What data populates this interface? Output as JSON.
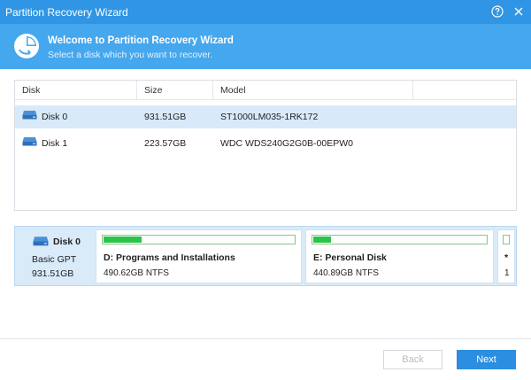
{
  "window": {
    "title": "Partition Recovery Wizard"
  },
  "icons": {
    "help": "help-icon",
    "close": "close-icon",
    "logo": "partition-recovery-logo-icon",
    "disk": "hard-disk-icon"
  },
  "banner": {
    "title": "Welcome to Partition Recovery Wizard",
    "subtitle": "Select a disk which you want to recover."
  },
  "table": {
    "columns": [
      "Disk",
      "Size",
      "Model"
    ],
    "rows": [
      {
        "disk": "Disk 0",
        "size": "931.51GB",
        "model": "ST1000LM035-1RK172",
        "selected": true
      },
      {
        "disk": "Disk 1",
        "size": "223.57GB",
        "model": "WDC WDS240G2G0B-00EPW0",
        "selected": false
      }
    ]
  },
  "disk_map": {
    "disk_name": "Disk 0",
    "disk_type": "Basic GPT",
    "disk_size": "931.51GB",
    "partitions": [
      {
        "name": "D: Programs and Installations",
        "info": "490.62GB NTFS",
        "used_fraction": 0.2
      },
      {
        "name": "E: Personal Disk",
        "info": "440.89GB NTFS",
        "used_fraction": 0.1
      },
      {
        "name": "*",
        "info": "1"
      }
    ]
  },
  "colors": {
    "titlebar": "#2f95e4",
    "banner": "#45a7ee",
    "selected_row": "#d8eafa",
    "used_bar": "#2bc44a",
    "primary_button": "#2b8ee0"
  },
  "buttons": {
    "back": "Back",
    "next": "Next"
  }
}
